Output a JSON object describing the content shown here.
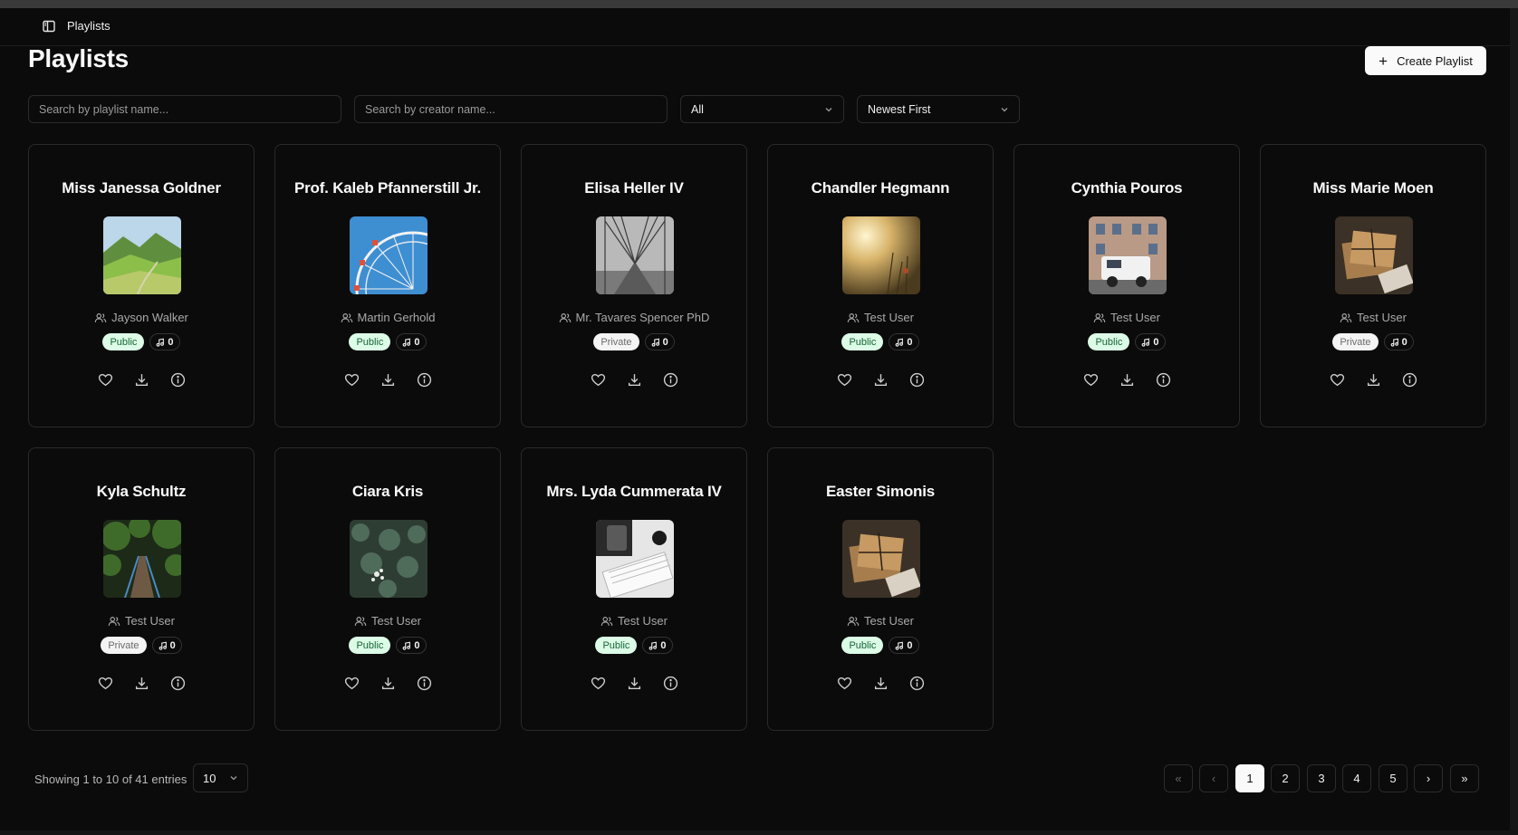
{
  "header": {
    "breadcrumb": "Playlists",
    "title": "Playlists",
    "create_label": "Create Playlist"
  },
  "filters": {
    "playlist_search_placeholder": "Search by playlist name...",
    "creator_search_placeholder": "Search by creator name...",
    "visibility_value": "All",
    "sort_value": "Newest First"
  },
  "playlists": [
    {
      "title": "Miss Janessa Goldner",
      "creator": "Jayson Walker",
      "visibility": "Public",
      "tracks": "0",
      "cover": "mountain-meadow"
    },
    {
      "title": "Prof. Kaleb Pfannerstill Jr.",
      "creator": "Martin Gerhold",
      "visibility": "Public",
      "tracks": "0",
      "cover": "ferris-wheel"
    },
    {
      "title": "Elisa Heller IV",
      "creator": "Mr. Tavares Spencer PhD",
      "visibility": "Private",
      "tracks": "0",
      "cover": "bridge"
    },
    {
      "title": "Chandler Hegmann",
      "creator": "Test User",
      "visibility": "Public",
      "tracks": "0",
      "cover": "sunlit-field"
    },
    {
      "title": "Cynthia Pouros",
      "creator": "Test User",
      "visibility": "Public",
      "tracks": "0",
      "cover": "building-jeep"
    },
    {
      "title": "Miss Marie Moen",
      "creator": "Test User",
      "visibility": "Private",
      "tracks": "0",
      "cover": "parcels"
    },
    {
      "title": "Kyla Schultz",
      "creator": "Test User",
      "visibility": "Private",
      "tracks": "0",
      "cover": "forest-bridge"
    },
    {
      "title": "Ciara Kris",
      "creator": "Test User",
      "visibility": "Public",
      "tracks": "0",
      "cover": "foliage"
    },
    {
      "title": "Mrs. Lyda Cummerata IV",
      "creator": "Test User",
      "visibility": "Public",
      "tracks": "0",
      "cover": "desk-keyboard"
    },
    {
      "title": "Easter Simonis",
      "creator": "Test User",
      "visibility": "Public",
      "tracks": "0",
      "cover": "parcels"
    }
  ],
  "pagination": {
    "showing_text": "Showing 1 to 10 of 41 entries",
    "page_size": "10",
    "pages": [
      "1",
      "2",
      "3",
      "4",
      "5"
    ],
    "current_page": "1",
    "first_icon": "«",
    "prev_icon": "‹",
    "next_icon": "›",
    "last_icon": "»"
  },
  "colors": {
    "background": "#0b0b0b",
    "public_badge_bg": "#dcfce7",
    "public_badge_text": "#166534",
    "private_badge_bg": "#f4f4f5",
    "primary_button_bg": "#fafafa"
  }
}
